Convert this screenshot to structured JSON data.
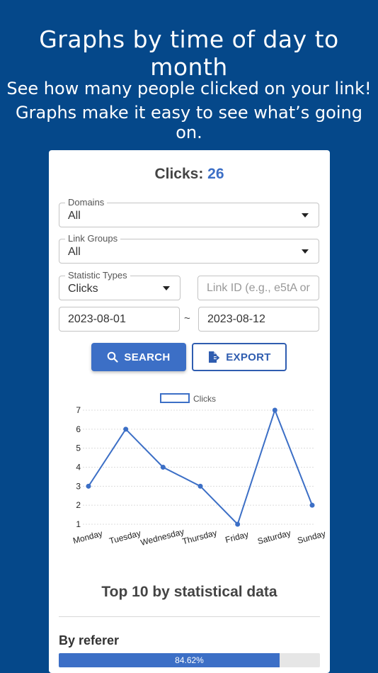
{
  "promo": {
    "title": "Graphs by time of day to month",
    "subtitle_line1": "See how many people clicked on your link!",
    "subtitle_line2": "Graphs make it easy to see what’s going on."
  },
  "summary": {
    "label": "Clicks:",
    "count": "26"
  },
  "filters": {
    "domains": {
      "label": "Domains",
      "value": "All"
    },
    "link_groups": {
      "label": "Link Groups",
      "value": "All"
    },
    "statistic_types": {
      "label": "Statistic Types",
      "value": "Clicks"
    },
    "link_id": {
      "placeholder": "Link ID (e.g., e5tA or"
    },
    "date_from": "2023-08-01",
    "date_separator": "~",
    "date_to": "2023-08-12"
  },
  "actions": {
    "search_label": "SEARCH",
    "export_label": "EXPORT"
  },
  "chart_data": {
    "type": "line",
    "categories": [
      "Monday",
      "Tuesday",
      "Wednesday",
      "Thursday",
      "Friday",
      "Saturday",
      "Sunday"
    ],
    "series": [
      {
        "name": "Clicks",
        "values": [
          3,
          6,
          4,
          3,
          1,
          7,
          2
        ],
        "color": "#3c6fc6"
      }
    ],
    "yticks": [
      1,
      2,
      3,
      4,
      5,
      6,
      7
    ],
    "ylim": [
      1,
      7
    ],
    "legend": "top-center",
    "grid": true
  },
  "stats": {
    "title": "Top 10 by statistical data",
    "by_referer": {
      "label": "By referer",
      "percent_text": "84.62%",
      "fraction": 0.8462
    }
  },
  "colors": {
    "background": "#05488a",
    "accent": "#3c6fc6"
  }
}
